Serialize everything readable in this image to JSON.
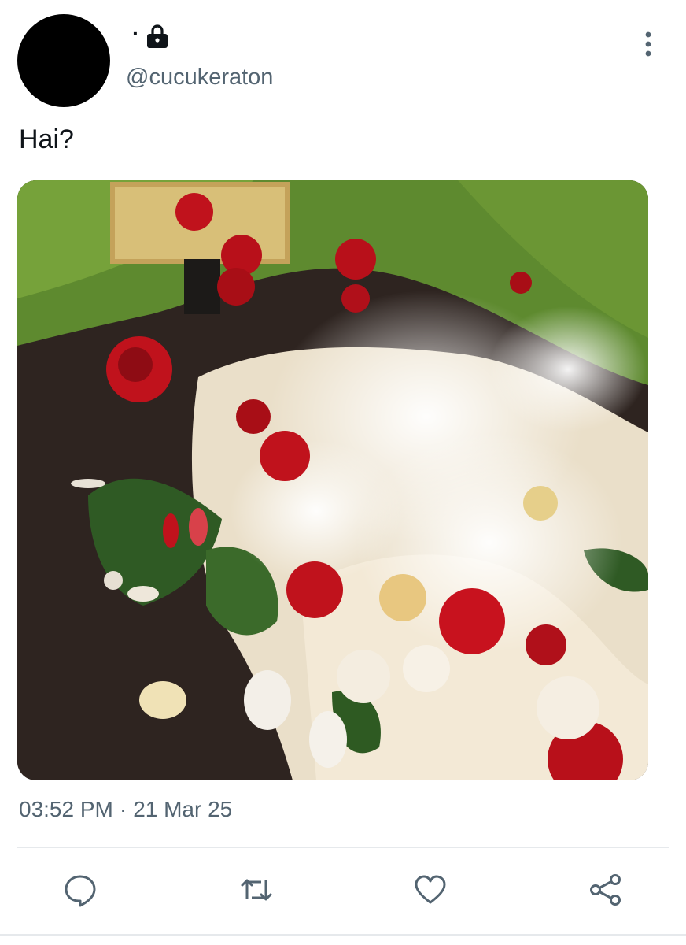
{
  "tweet": {
    "display_name": "",
    "separator": "·",
    "handle": "@cucukeraton",
    "text": "Hai?",
    "media_description_icon": "photo-of-grave-with-flowers",
    "time": "03:52 PM",
    "dot": "·",
    "date": "21 Mar 25"
  },
  "icons": {
    "lock": "lock-icon",
    "more": "more-vertical-icon",
    "reply": "reply-icon",
    "retweet": "retweet-icon",
    "like": "heart-icon",
    "share": "share-icon"
  },
  "colors": {
    "text_primary": "#0f1419",
    "text_secondary": "#536471",
    "icon": "#536471",
    "divider": "#e6e9ec"
  }
}
